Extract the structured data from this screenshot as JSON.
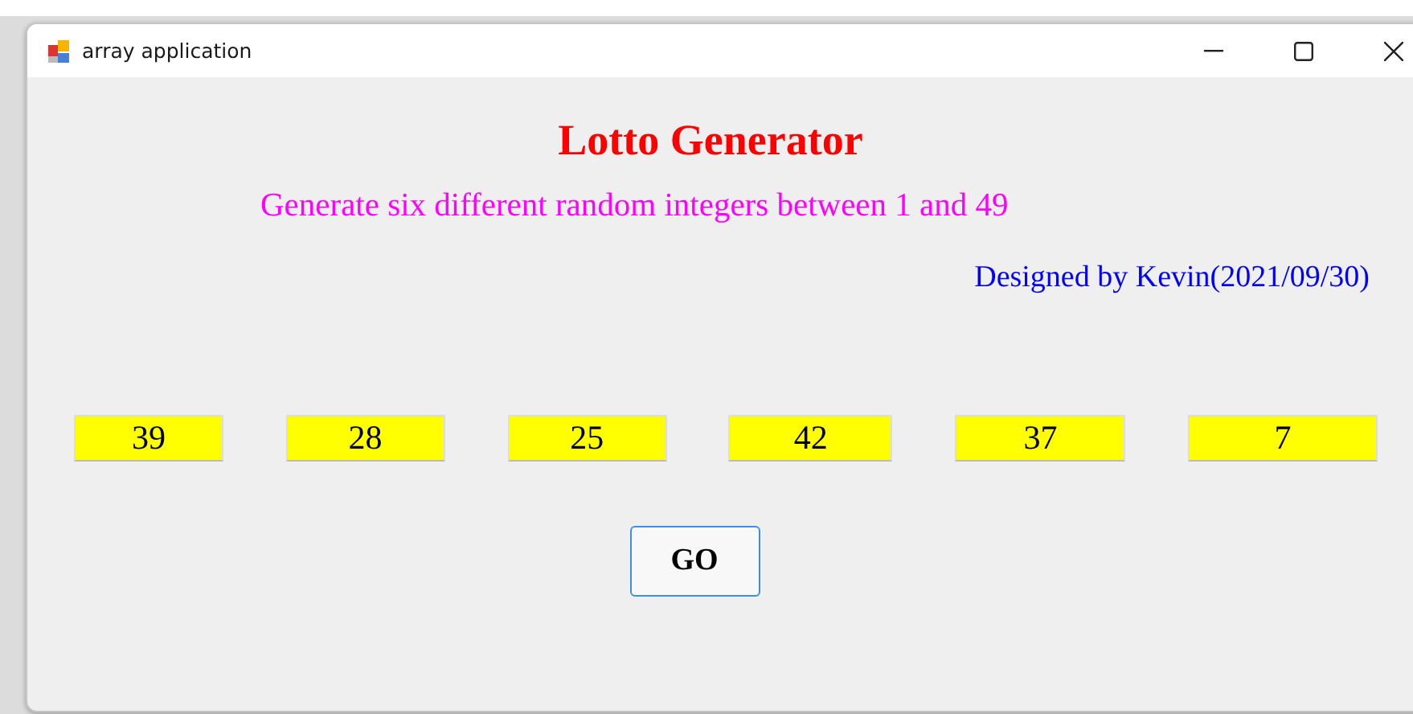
{
  "window": {
    "title": "array application"
  },
  "heading": "Lotto Generator",
  "subtitle": "Generate six different random integers between 1 and 49",
  "credit": "Designed by Kevin(2021/09/30)",
  "numbers": [
    "39",
    "28",
    "25",
    "42",
    "37",
    "7"
  ],
  "go_button": "GO"
}
